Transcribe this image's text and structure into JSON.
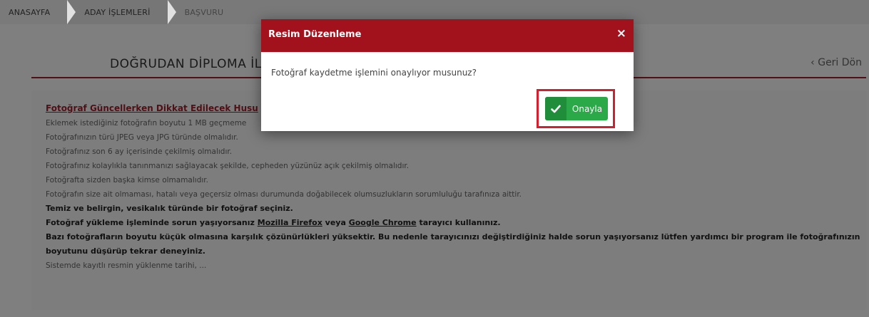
{
  "breadcrumb": {
    "items": [
      "ANASAYFA",
      "ADAY İŞLEMLERİ",
      "BAŞVURU"
    ]
  },
  "page": {
    "title": "DOĞRUDAN DİPLOMA İLE",
    "back_label": "Geri Dön"
  },
  "instructions": {
    "heading": "Fotoğraf Güncellerken Dikkat Edilecek Husu",
    "lines": [
      "Eklemek istediğiniz fotoğrafın boyutu 1 MB geçmeme",
      "Fotoğrafınızın türü JPEG veya JPG türünde olmalıdır.",
      "Fotoğrafınız son 6 ay içerisinde çekilmiş olmalıdır.",
      "Fotoğrafınız kolaylıkla tanınmanızı sağlayacak şekilde, cepheden yüzünüz açık çekilmiş olmalıdır.",
      "Fotoğrafta sizden başka kimse olmamalıdır.",
      "Fotoğrafın size ait olmaması, hatalı veya geçersiz olması durumunda doğabilecek olumsuzlukların sorumluluğu tarafınıza aittir."
    ],
    "bold1": "Temiz ve belirgin, vesikalık türünde bir fotoğraf seçiniz.",
    "bold2": {
      "pre": "Fotoğraf yükleme işleminde sorun yaşıyorsanız ",
      "link1": "Mozilla Firefox",
      "mid": " veya ",
      "link2": "Google Chrome",
      "post": " tarayıcı kullanınız."
    },
    "bold3a": "Bazı fotoğrafların boyutu küçük olmasına karşılık çözünürlükleri yüksektir. Bu nedenle tarayıcınızı değiştirdiğiniz halde sorun yaşıyorsanız lütfen yardımcı bir program ile fotoğrafınızın",
    "bold3b": "boyutunu düşürüp tekrar deneyiniz.",
    "last": "Sistemde kayıtlı resmin yüklenme tarihi, ..."
  },
  "modal": {
    "title": "Resim Düzenleme",
    "close_glyph": "×",
    "body": "Fotoğraf kaydetme işlemini onaylıyor musunuz?",
    "confirm_label": "Onayla",
    "confirm_icon": "check-icon"
  },
  "colors": {
    "brand_red": "#a1121d",
    "confirm_green": "#2ba847",
    "highlight": "#d2202f"
  }
}
